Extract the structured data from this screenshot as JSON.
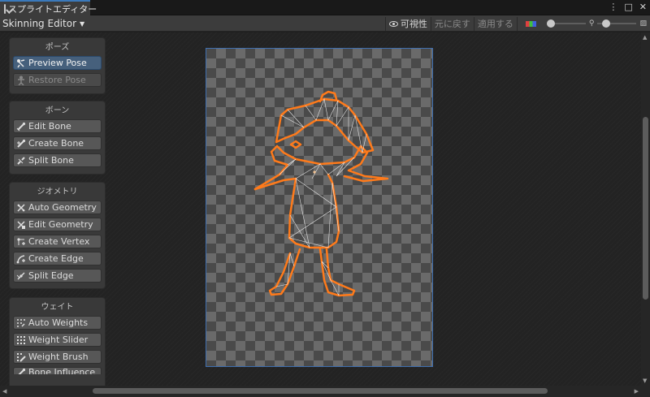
{
  "window": {
    "title": "スプライトエディター",
    "controls": [
      "⋮",
      "□",
      "✕"
    ]
  },
  "toolbar": {
    "mode": "Skinning Editor",
    "visibility": "可視性",
    "revert": "元に戻す",
    "apply": "適用する"
  },
  "panels": [
    {
      "title": "ポーズ",
      "buttons": [
        {
          "label": "Preview Pose",
          "icon": "preview-pose-icon",
          "state": "active"
        },
        {
          "label": "Restore Pose",
          "icon": "restore-pose-icon",
          "state": "disabled"
        }
      ]
    },
    {
      "title": "ボーン",
      "buttons": [
        {
          "label": "Edit Bone",
          "icon": "edit-bone-icon",
          "state": "normal"
        },
        {
          "label": "Create Bone",
          "icon": "create-bone-icon",
          "state": "normal"
        },
        {
          "label": "Split Bone",
          "icon": "split-bone-icon",
          "state": "normal"
        }
      ]
    },
    {
      "title": "ジオメトリ",
      "buttons": [
        {
          "label": "Auto Geometry",
          "icon": "auto-geometry-icon",
          "state": "normal"
        },
        {
          "label": "Edit Geometry",
          "icon": "edit-geometry-icon",
          "state": "normal"
        },
        {
          "label": "Create Vertex",
          "icon": "create-vertex-icon",
          "state": "normal"
        },
        {
          "label": "Create Edge",
          "icon": "create-edge-icon",
          "state": "normal"
        },
        {
          "label": "Split Edge",
          "icon": "split-edge-icon",
          "state": "normal"
        }
      ]
    },
    {
      "title": "ウェイト",
      "buttons": [
        {
          "label": "Auto Weights",
          "icon": "auto-weights-icon",
          "state": "normal"
        },
        {
          "label": "Weight Slider",
          "icon": "weight-slider-icon",
          "state": "normal"
        },
        {
          "label": "Weight Brush",
          "icon": "weight-brush-icon",
          "state": "normal"
        },
        {
          "label": "Bone Influence",
          "icon": "bone-influence-icon",
          "state": "normal"
        }
      ]
    }
  ],
  "colors": {
    "accent": "#3a79bb",
    "mesh_outline": "#ff7a1a",
    "active_button": "#46607c"
  }
}
